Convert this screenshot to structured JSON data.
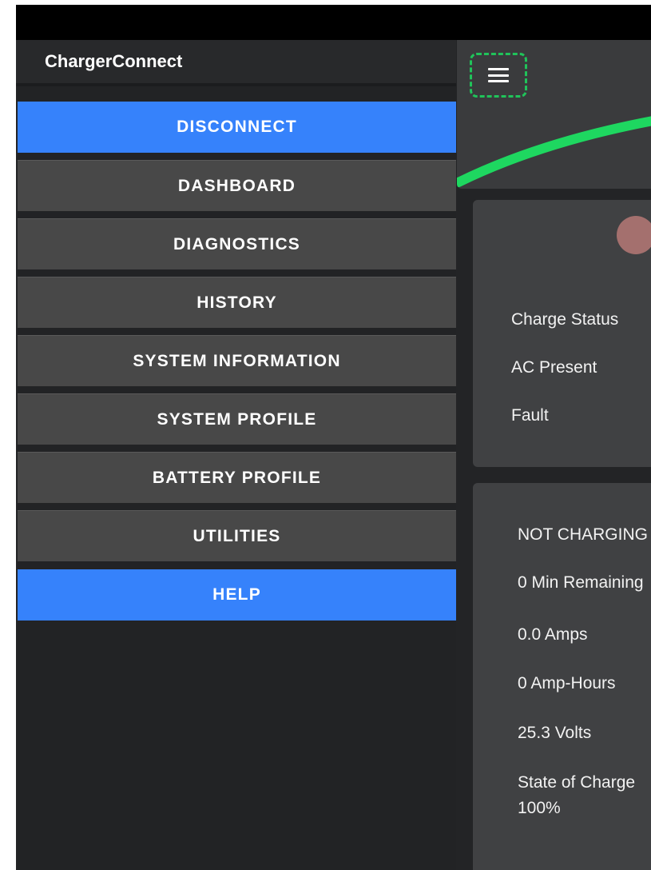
{
  "app": {
    "title": "ChargerConnect"
  },
  "colors": {
    "accent_blue": "#3682fb",
    "button_gray": "#484848",
    "gauge_green": "#1ed760",
    "status_dot": "#a4706e",
    "menu_highlight": "#20c35a"
  },
  "header": {
    "menu_icon": "hamburger-menu-icon"
  },
  "nav": {
    "items": [
      {
        "label": "DISCONNECT",
        "style": "primary"
      },
      {
        "label": "DASHBOARD",
        "style": "secondary"
      },
      {
        "label": "DIAGNOSTICS",
        "style": "secondary"
      },
      {
        "label": "HISTORY",
        "style": "secondary"
      },
      {
        "label": "SYSTEM INFORMATION",
        "style": "secondary"
      },
      {
        "label": "SYSTEM PROFILE",
        "style": "secondary"
      },
      {
        "label": "BATTERY PROFILE",
        "style": "secondary"
      },
      {
        "label": "UTILITIES",
        "style": "secondary"
      },
      {
        "label": "HELP",
        "style": "primary"
      }
    ]
  },
  "status_card": {
    "labels": [
      "Charge Status",
      "AC Present",
      "Fault"
    ]
  },
  "charge_card": {
    "status": "NOT CHARGING",
    "time_remaining": "0 Min Remaining",
    "amps": "0.0 Amps",
    "amp_hours": "0 Amp-Hours",
    "volts": "25.3 Volts",
    "state_of_charge_label": "State of Charge",
    "state_of_charge_value": "100%"
  }
}
